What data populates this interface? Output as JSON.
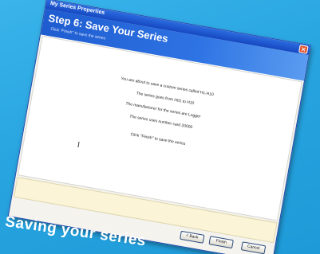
{
  "window": {
    "title": "My Series Properties"
  },
  "header": {
    "step_title": "Step 6: Save Your Series",
    "instruction": "Click \"Finish\" to save the series"
  },
  "content": {
    "lines": [
      "You are about to save a custom series called H1-H10",
      "The series goes from H01 to H10",
      "The manufacturer for the series are Logger",
      "The series uses number card 20000",
      "Click \"Finish\" to save the series"
    ],
    "cursor_glyph": "I"
  },
  "buttons": {
    "back": "< Back",
    "finish": "Finish",
    "cancel": "Cancel"
  },
  "caption": "Saving your series",
  "colors": {
    "background": "#28a4e0",
    "header": "#2f74e4",
    "note_bar": "#fbf4d6"
  }
}
